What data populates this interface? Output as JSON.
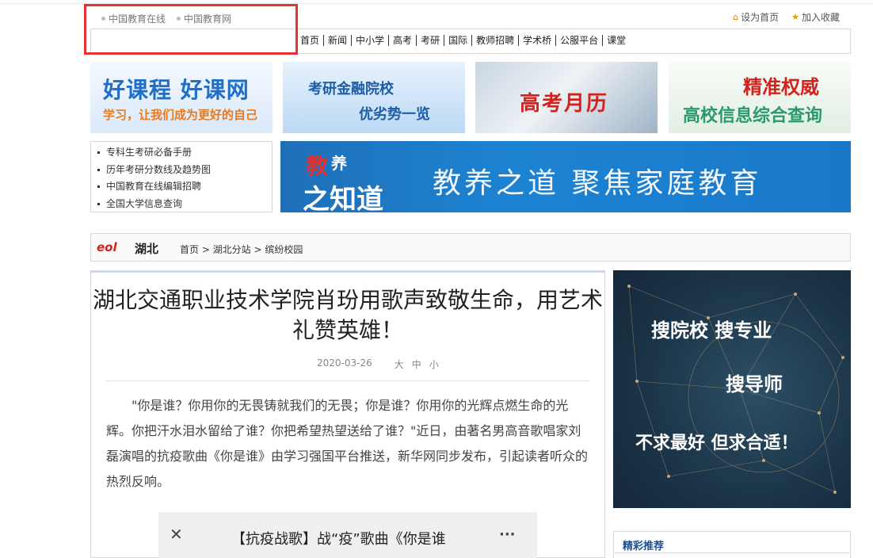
{
  "top": {
    "links": [
      "中国教育在线",
      "中国教育网"
    ],
    "set_home": "设为首页",
    "favorite": "加入收藏"
  },
  "nav": {
    "items": [
      "首页",
      "新闻",
      "中小学",
      "高考",
      "考研",
      "国际",
      "教师招聘",
      "学术桥",
      "公服平台",
      "课堂"
    ]
  },
  "banners": {
    "b1_line1": "好课程 好课网",
    "b1_line2": "学习，让我们成为更好的自己",
    "b2_line1": "考研金融院校",
    "b2_line2": "优劣势一览",
    "b3_line1": "高考月历",
    "b4_line1": "精准权威",
    "b4_line2": "高校信息综合查询"
  },
  "sidelist": [
    "专科生考研必备手册",
    "历年考研分数线及趋势图",
    "中国教育在线编辑招聘",
    "全国大学信息查询"
  ],
  "bigbanner": {
    "logo_1": "教",
    "logo_2": "养",
    "logo_3": "之知道",
    "slogan": "教养之道 聚焦家庭教育"
  },
  "breadcrumb": {
    "brand": "eol",
    "region": "湖北",
    "path": "首页 > 湖北分站 > 缤纷校园"
  },
  "article": {
    "title": "湖北交通职业技术学院肖玢用歌声致敬生命，用艺术礼赞英雄！",
    "date": "2020-03-26",
    "size_large": "大",
    "size_medium": "中",
    "size_small": "小",
    "paragraph": "\"你是谁？你用你的无畏铸就我们的无畏；你是谁？你用你的光辉点燃生命的光辉。你把汗水泪水留给了谁？你把希望热望送给了谁？\"近日，由著名男高音歌唱家刘磊演唱的抗疫歌曲《你是谁》由学习强国平台推送，新华网同步发布，引起读者听众的热烈反响。"
  },
  "video": {
    "close": "✕",
    "title": "【抗疫战歌】战“疫”歌曲《你是谁",
    "more": "···"
  },
  "ad": {
    "line1": "搜院校 搜专业",
    "line2": "搜导师",
    "line3": "不求最好 但求合适！"
  },
  "recommend": {
    "title": "精彩推荐"
  }
}
